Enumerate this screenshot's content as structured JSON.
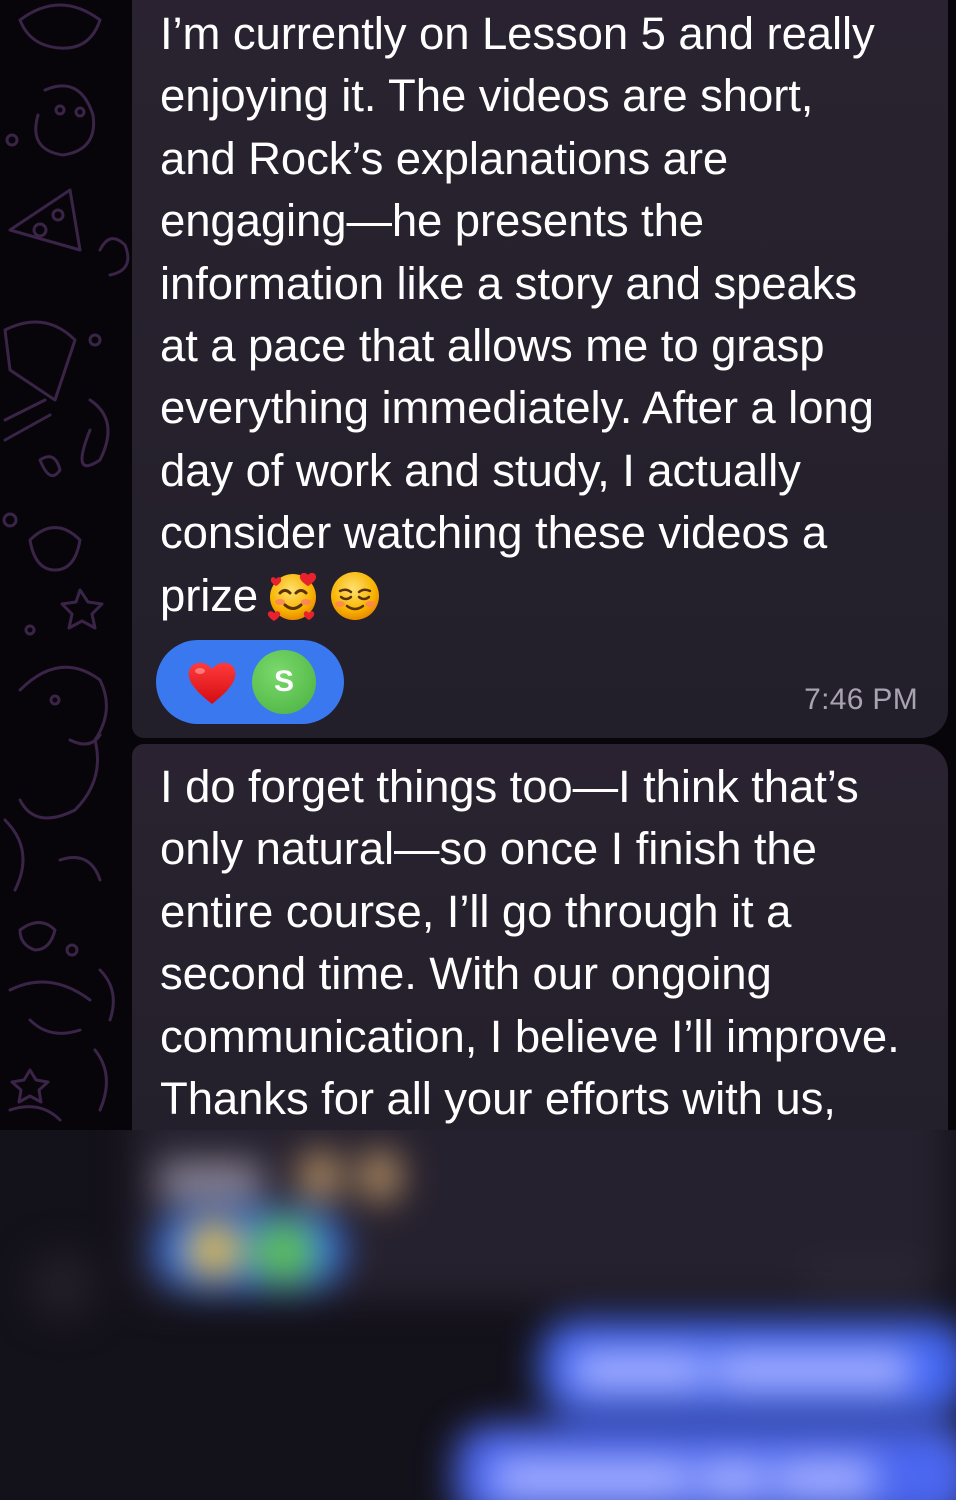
{
  "chat": {
    "messages": [
      {
        "lines": [
          "I’m currently on Lesson 5 and really",
          "enjoying it. The videos are short,",
          "and Rock’s explanations are",
          "engaging—he presents the",
          "information like a story and speaks",
          "at a pace that allows me to grasp",
          "everything immediately. After a long",
          "day of work and study, I actually",
          "consider watching these videos a"
        ],
        "last_line": "prize",
        "emojis": [
          "smiling-face-with-hearts-emoji",
          "smiling-face-emoji"
        ],
        "reaction": {
          "emoji": "heart-icon",
          "reactor_initial": "S",
          "reactor_color": "#5cc151",
          "pill_color": "#3a78f0"
        },
        "time": "7:46 PM"
      },
      {
        "lines": [
          "I do forget things too—I think that’s",
          "only natural—so once I finish the",
          "entire course, I’ll go through it a",
          "second time. With our ongoing",
          "communication, I believe I’ll improve.",
          "Thanks for all your efforts with us,"
        ]
      }
    ]
  },
  "colors": {
    "background": "#070509",
    "incoming_bubble": "#26212d",
    "outgoing_bubble": "#4467f2",
    "timestamp": "#aaa2b0"
  }
}
